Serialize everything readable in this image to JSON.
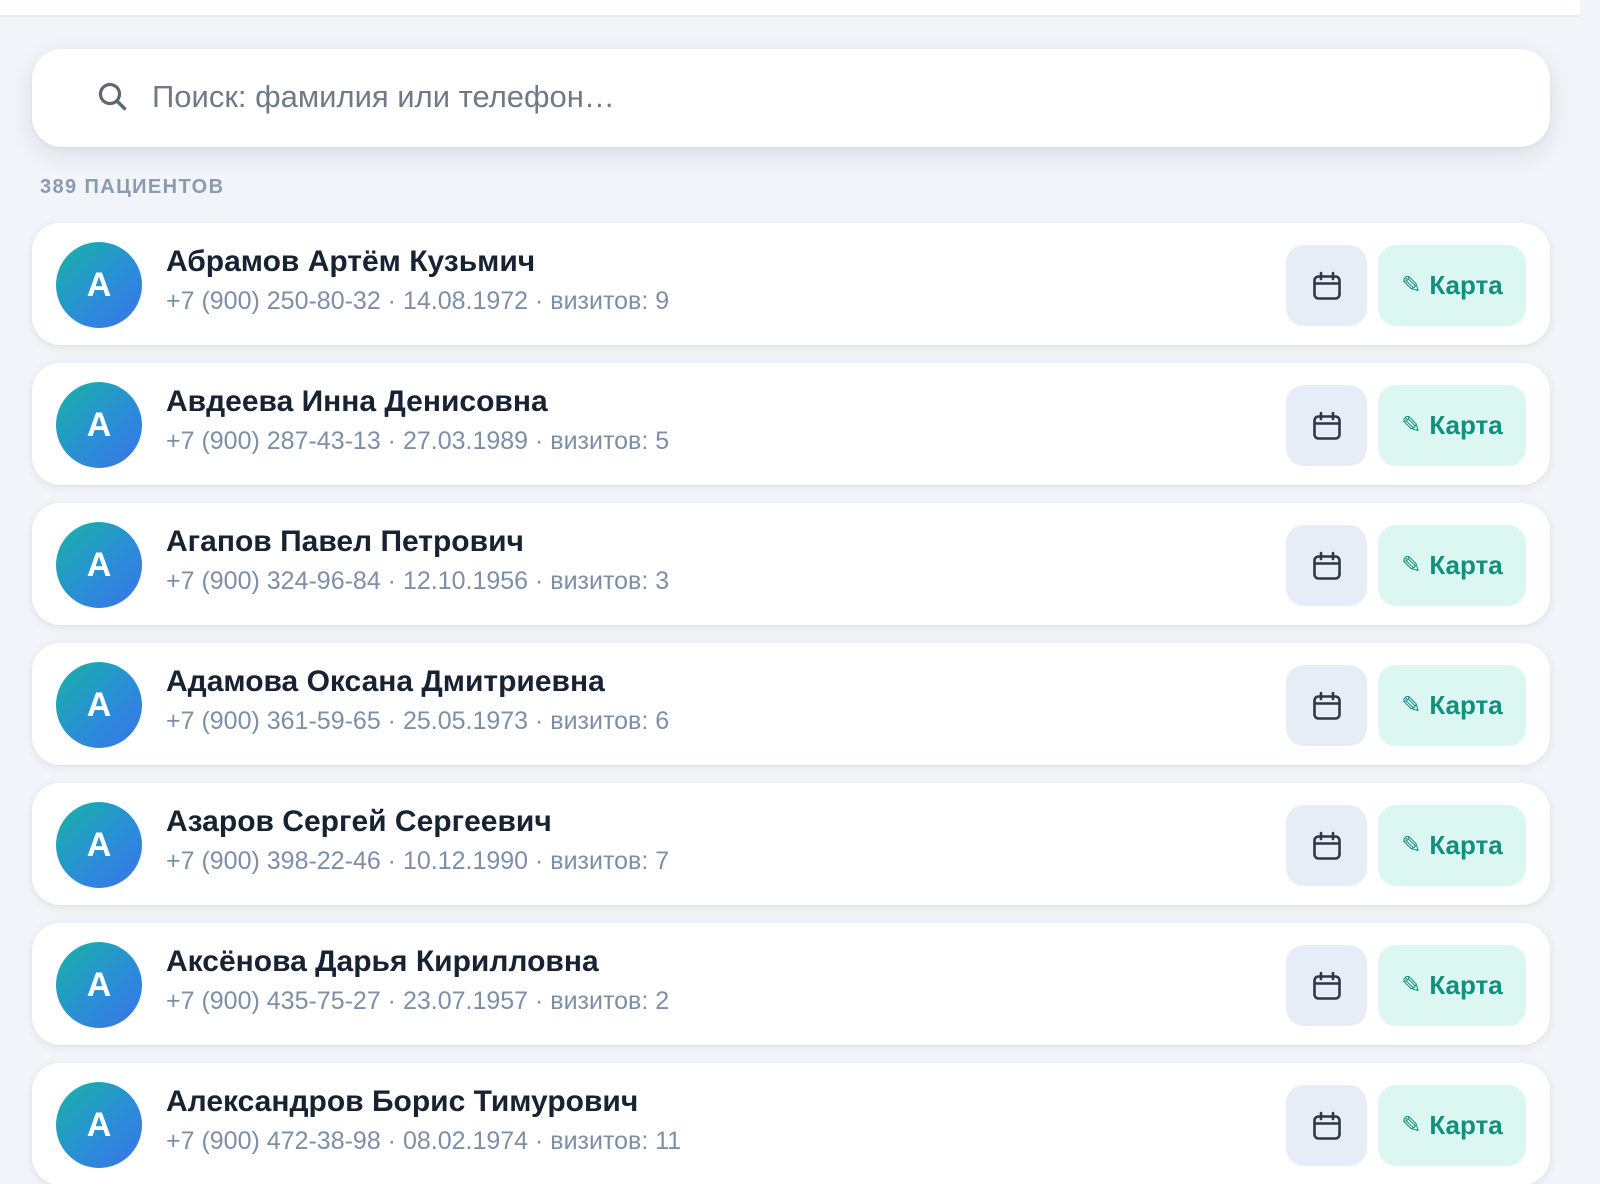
{
  "search": {
    "placeholder": "Поиск: фамилия или телефон…",
    "icon": "search-icon"
  },
  "list_header": {
    "count_label": "389 ПАЦИЕНТОВ"
  },
  "patients": [
    {
      "initial": "А",
      "name": "Абрамов Артём Кузьмич",
      "meta": "+7 (900) 250-80-32 · 14.08.1972 · визитов: 9",
      "card_label": "Карта",
      "card_icon": "✎"
    },
    {
      "initial": "А",
      "name": "Авдеева Инна Денисовна",
      "meta": "+7 (900) 287-43-13 · 27.03.1989 · визитов: 5",
      "card_label": "Карта",
      "card_icon": "✎"
    },
    {
      "initial": "А",
      "name": "Агапов Павел Петрович",
      "meta": "+7 (900) 324-96-84 · 12.10.1956 · визитов: 3",
      "card_label": "Карта",
      "card_icon": "✎"
    },
    {
      "initial": "А",
      "name": "Адамова Оксана Дмитриевна",
      "meta": "+7 (900) 361-59-65 · 25.05.1973 · визитов: 6",
      "card_label": "Карта",
      "card_icon": "✎"
    },
    {
      "initial": "А",
      "name": "Азаров Сергей Сергеевич",
      "meta": "+7 (900) 398-22-46 · 10.12.1990 · визитов: 7",
      "card_label": "Карта",
      "card_icon": "✎"
    },
    {
      "initial": "А",
      "name": "Аксёнова Дарья Кирилловна",
      "meta": "+7 (900) 435-75-27 · 23.07.1957 · визитов: 2",
      "card_label": "Карта",
      "card_icon": "✎"
    },
    {
      "initial": "А",
      "name": "Александров Борис Тимурович",
      "meta": "+7 (900) 472-38-98 · 08.02.1974 · визитов: 11",
      "card_label": "Карта",
      "card_icon": "✎"
    }
  ],
  "colors": {
    "page_background": "#f1f4f8",
    "accent": "#11907e",
    "card_button_background": "#dcf6f1",
    "calendar_button_background": "#e6edf6",
    "avatar_gradient_start": "#17b3a3",
    "avatar_gradient_end": "#3a73ea"
  }
}
